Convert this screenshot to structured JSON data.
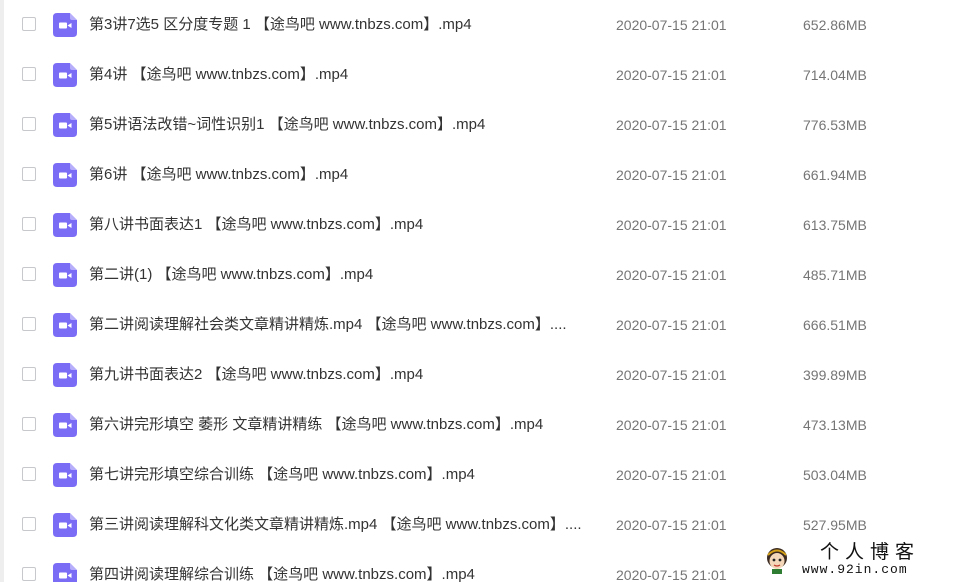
{
  "icon_color": "#7B6CF6",
  "files": [
    {
      "name": "第3讲7选5 区分度专题 1 【途鸟吧 www.tnbzs.com】.mp4",
      "date": "2020-07-15 21:01",
      "size": "652.86MB",
      "icon": "video-file-icon"
    },
    {
      "name": "第4讲 【途鸟吧 www.tnbzs.com】.mp4",
      "date": "2020-07-15 21:01",
      "size": "714.04MB",
      "icon": "video-file-icon"
    },
    {
      "name": "第5讲语法改错~词性识别1 【途鸟吧 www.tnbzs.com】.mp4",
      "date": "2020-07-15 21:01",
      "size": "776.53MB",
      "icon": "video-file-icon"
    },
    {
      "name": "第6讲 【途鸟吧 www.tnbzs.com】.mp4",
      "date": "2020-07-15 21:01",
      "size": "661.94MB",
      "icon": "video-file-icon"
    },
    {
      "name": "第八讲书面表达1 【途鸟吧 www.tnbzs.com】.mp4",
      "date": "2020-07-15 21:01",
      "size": "613.75MB",
      "icon": "video-file-icon"
    },
    {
      "name": "第二讲(1) 【途鸟吧 www.tnbzs.com】.mp4",
      "date": "2020-07-15 21:01",
      "size": "485.71MB",
      "icon": "video-file-icon"
    },
    {
      "name": "第二讲阅读理解社会类文章精讲精炼.mp4 【途鸟吧 www.tnbzs.com】....",
      "date": "2020-07-15 21:01",
      "size": "666.51MB",
      "icon": "video-file-icon"
    },
    {
      "name": "第九讲书面表达2 【途鸟吧 www.tnbzs.com】.mp4",
      "date": "2020-07-15 21:01",
      "size": "399.89MB",
      "icon": "video-file-icon"
    },
    {
      "name": "第六讲完形填空 萎形 文章精讲精练 【途鸟吧 www.tnbzs.com】.mp4",
      "date": "2020-07-15 21:01",
      "size": "473.13MB",
      "icon": "video-file-icon"
    },
    {
      "name": "第七讲完形填空综合训练 【途鸟吧 www.tnbzs.com】.mp4",
      "date": "2020-07-15 21:01",
      "size": "503.04MB",
      "icon": "video-file-icon"
    },
    {
      "name": "第三讲阅读理解科文化类文章精讲精炼.mp4 【途鸟吧 www.tnbzs.com】....",
      "date": "2020-07-15 21:01",
      "size": "527.95MB",
      "icon": "video-file-icon"
    },
    {
      "name": "第四讲阅读理解综合训练 【途鸟吧 www.tnbzs.com】.mp4",
      "date": "2020-07-15 21:01",
      "size": "",
      "icon": "video-file-icon"
    }
  ],
  "watermark": {
    "title": "个人博客",
    "url": "www.92in.com"
  }
}
